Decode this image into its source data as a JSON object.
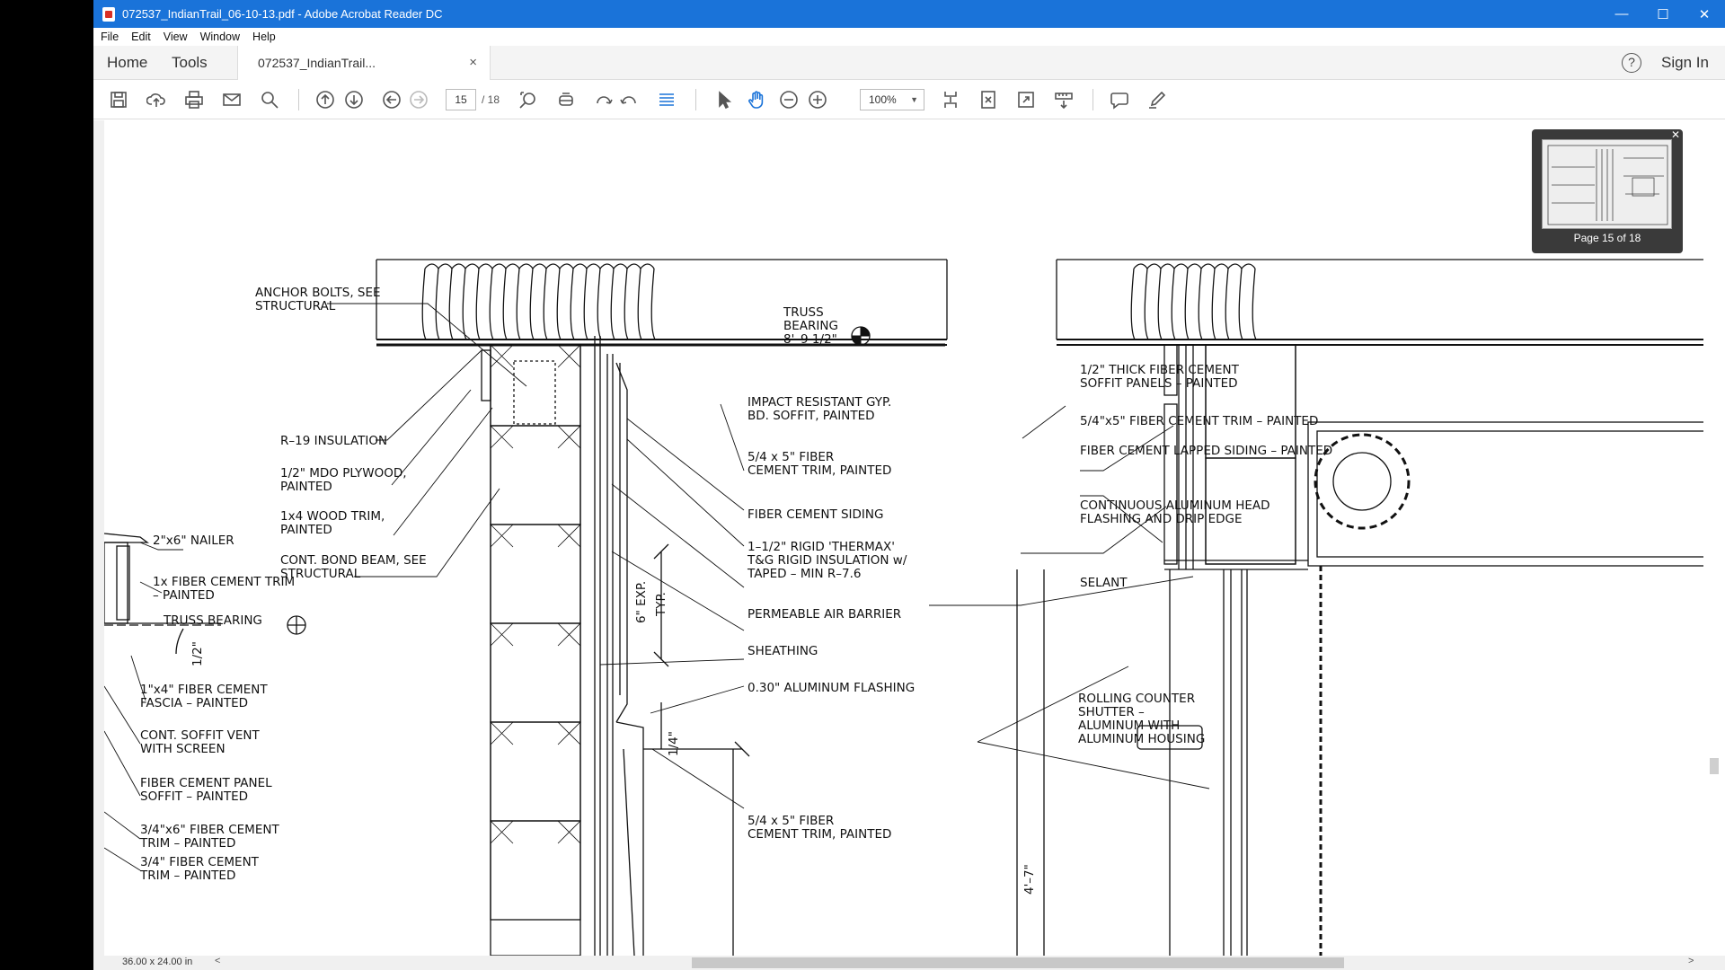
{
  "window": {
    "title": "072537_IndianTrail_06-10-13.pdf - Adobe Acrobat Reader DC",
    "minimize": "—",
    "maximize": "☐",
    "close": "✕"
  },
  "menu": [
    "File",
    "Edit",
    "View",
    "Window",
    "Help"
  ],
  "tabs": {
    "home": "Home",
    "tools": "Tools",
    "doc": "072537_IndianTrail...",
    "doc_close": "×"
  },
  "account": {
    "help": "?",
    "sign_in": "Sign In"
  },
  "toolbar": {
    "page_current": "15",
    "page_total": "/ 18",
    "zoom": "100%",
    "zoom_caret": "▼"
  },
  "thumbnail": {
    "label": "Page 15 of 18",
    "close": "✕"
  },
  "status": {
    "page_size": "36.00 x 24.00 in",
    "left_arrow": "<",
    "right_arrow": ">"
  },
  "drawing": {
    "labels_left": [
      {
        "lines": [
          "ANCHOR BOLTS, SEE",
          "STRUCTURAL"
        ]
      },
      {
        "lines": [
          "R–19 INSULATION"
        ]
      },
      {
        "lines": [
          "1/2\" MDO PLYWOOD,",
          "PAINTED"
        ]
      },
      {
        "lines": [
          "1x4 WOOD TRIM,",
          "PAINTED"
        ]
      },
      {
        "lines": [
          "CONT. BOND BEAM, SEE",
          "STRUCTURAL"
        ]
      },
      {
        "lines": [
          "2\"x6\" NAILER"
        ]
      },
      {
        "lines": [
          "1x FIBER CEMENT TRIM",
          "– PAINTED"
        ]
      },
      {
        "lines": [
          "TRUSS BEARING"
        ]
      },
      {
        "lines": [
          "1\"x4\" FIBER CEMENT",
          "FASCIA – PAINTED"
        ]
      },
      {
        "lines": [
          "CONT. SOFFIT VENT",
          "WITH SCREEN"
        ]
      },
      {
        "lines": [
          "FIBER CEMENT PANEL",
          "SOFFIT – PAINTED"
        ]
      },
      {
        "lines": [
          "3/4\"x6\" FIBER CEMENT",
          "TRIM – PAINTED"
        ]
      },
      {
        "lines": [
          "3/4\" FIBER CEMENT",
          "TRIM – PAINTED"
        ]
      }
    ],
    "labels_mid": [
      {
        "lines": [
          "TRUSS",
          "BEARING",
          "8'–9 1/2\""
        ]
      },
      {
        "lines": [
          "IMPACT RESISTANT GYP.",
          "BD. SOFFIT, PAINTED"
        ]
      },
      {
        "lines": [
          "5/4 x 5\" FIBER",
          "CEMENT TRIM, PAINTED"
        ]
      },
      {
        "lines": [
          "FIBER CEMENT SIDING"
        ]
      },
      {
        "lines": [
          "1–1/2\" RIGID 'THERMAX'",
          "T&G RIGID INSULATION w/",
          "TAPED – MIN R–7.6"
        ]
      },
      {
        "lines": [
          "PERMEABLE AIR BARRIER"
        ]
      },
      {
        "lines": [
          "SHEATHING"
        ]
      },
      {
        "lines": [
          "0.30\" ALUMINUM FLASHING"
        ]
      },
      {
        "lines": [
          "5/4 x 5\" FIBER",
          "CEMENT TRIM, PAINTED"
        ]
      }
    ],
    "labels_right": [
      {
        "lines": [
          "1/2\" THICK FIBER CEMENT",
          "SOFFIT PANELS – PAINTED"
        ]
      },
      {
        "lines": [
          "5/4\"x5\" FIBER CEMENT TRIM – PAINTED"
        ]
      },
      {
        "lines": [
          "FIBER CEMENT LAPPED SIDING – PAINTED"
        ]
      },
      {
        "lines": [
          "CONTINUOUS ALUMINUM HEAD",
          "FLASHING AND DRIP EDGE"
        ]
      },
      {
        "lines": [
          "SELANT"
        ]
      },
      {
        "lines": [
          "ROLLING COUNTER",
          "SHUTTER –",
          "ALUMINUM WITH",
          "ALUMINUM HOUSING"
        ]
      }
    ],
    "dims": {
      "exp": "6\" EXP.",
      "typ": "TYP.",
      "quarter": "1/4\"",
      "half": "1/2\"",
      "height": "4'–7\""
    }
  }
}
